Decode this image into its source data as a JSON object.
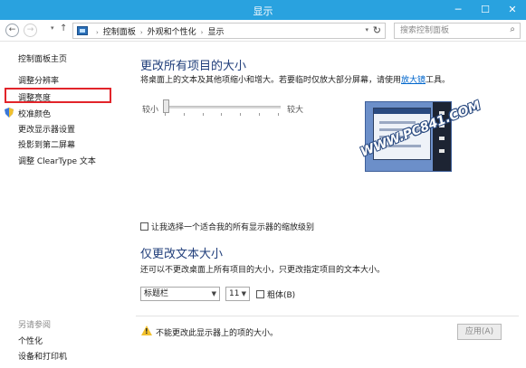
{
  "window": {
    "title": "显示"
  },
  "nav": {
    "back_glyph": "←",
    "forward_glyph": "→",
    "up_glyph": "↑",
    "dropdown_glyph": "▾"
  },
  "address": {
    "crumbs": [
      "控制面板",
      "外观和个性化",
      "显示"
    ],
    "separator_glyph": "›",
    "refresh_glyph": "↻"
  },
  "search": {
    "placeholder": "搜索控制面板",
    "icon": "search-icon"
  },
  "sidebar": {
    "items": [
      {
        "label": "控制面板主页"
      },
      {
        "label": "调整分辨率"
      },
      {
        "label": "调整亮度"
      },
      {
        "label": "校准颜色"
      },
      {
        "label": "更改显示器设置"
      },
      {
        "label": "投影到第二屏幕"
      },
      {
        "label": "调整 ClearType 文本"
      }
    ],
    "see_also_heading": "另请参阅",
    "see_also": [
      {
        "label": "个性化"
      },
      {
        "label": "设备和打印机"
      }
    ]
  },
  "main": {
    "title": "更改所有项目的大小",
    "desc_before": "将桌面上的文本及其他项缩小和增大。若要临时仅放大部分屏幕，请使用",
    "desc_link": "放大镜",
    "desc_after": "工具。",
    "slider": {
      "min_label": "较小",
      "max_label": "较大",
      "value_fraction": 0.0
    },
    "checkbox_label": "让我选择一个适合我的所有显示器的缩放级别",
    "text_title": "仅更改文本大小",
    "text_desc": "还可以不更改桌面上所有项目的大小，只更改指定项目的文本大小。",
    "item_select": "标题栏",
    "size_select": "11",
    "bold_label": "粗体(B)",
    "warning": "不能更改此显示器上的项的大小。",
    "apply_label": "应用(A)"
  },
  "watermark": "WWW.PC841.COM",
  "colors": {
    "titlebar": "#29a2df",
    "heading": "#1f3d7a",
    "link": "#0066cc",
    "highlight": "#e2242a"
  }
}
